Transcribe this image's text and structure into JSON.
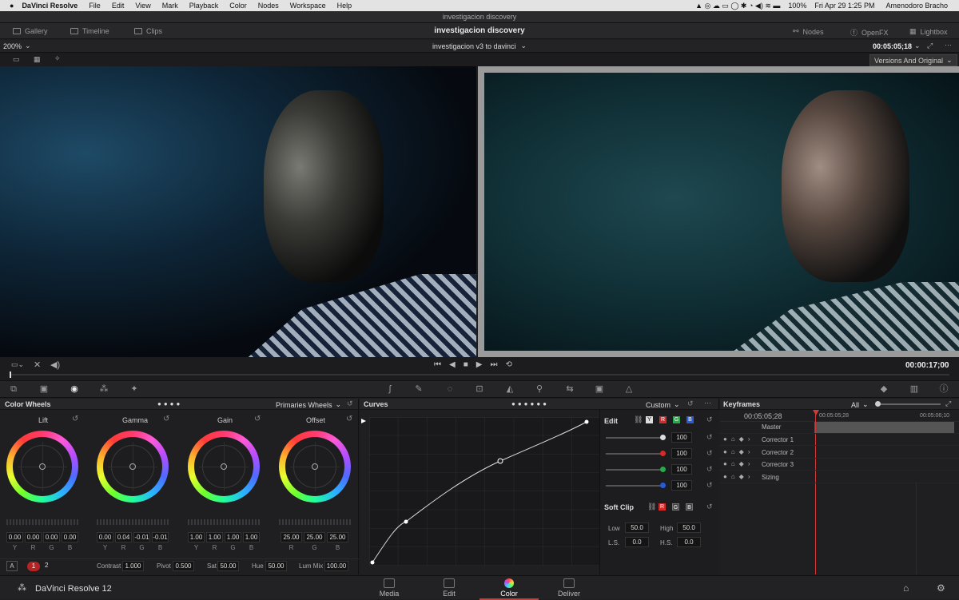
{
  "menubar": {
    "apple": "",
    "app": "DaVinci Resolve",
    "items": [
      "File",
      "Edit",
      "View",
      "Mark",
      "Playback",
      "Color",
      "Nodes",
      "Workspace",
      "Help"
    ],
    "battery": "100%",
    "datetime": "Fri Apr 29  1:25 PM",
    "user": "Amenodoro Bracho"
  },
  "window_title": "investigacion discovery",
  "topbar": {
    "gallery": "Gallery",
    "timeline": "Timeline",
    "clips": "Clips",
    "project": "investigacion discovery",
    "nodes": "Nodes",
    "openfx": "OpenFX",
    "lightbox": "Lightbox"
  },
  "toolbar2": {
    "zoom": "200%",
    "timeline_name": "investigacion v3 to davinci",
    "timecode": "00:05:05;18"
  },
  "toolbar3": {
    "versions": "Versions And Original"
  },
  "transport": {
    "timecode": "00:00:17;00"
  },
  "colorwheels": {
    "title": "Color Wheels",
    "mode": "Primaries Wheels",
    "wheels": [
      {
        "name": "Lift",
        "values": [
          "0.00",
          "0.00",
          "0.00",
          "0.00"
        ],
        "labels": [
          "Y",
          "R",
          "G",
          "B"
        ]
      },
      {
        "name": "Gamma",
        "values": [
          "0.00",
          "0.04",
          "-0.01",
          "-0.01"
        ],
        "labels": [
          "Y",
          "R",
          "G",
          "B"
        ]
      },
      {
        "name": "Gain",
        "values": [
          "1.00",
          "1.00",
          "1.00",
          "1.00"
        ],
        "labels": [
          "Y",
          "R",
          "G",
          "B"
        ]
      },
      {
        "name": "Offset",
        "values": [
          "25.00",
          "25.00",
          "25.00"
        ],
        "labels": [
          "R",
          "G",
          "B"
        ]
      }
    ],
    "footer": {
      "a": "A",
      "page1": "1",
      "page2": "2",
      "contrast_label": "Contrast",
      "contrast": "1.000",
      "pivot_label": "Pivot",
      "pivot": "0.500",
      "sat_label": "Sat",
      "sat": "50.00",
      "hue_label": "Hue",
      "hue": "50.00",
      "lummix_label": "Lum Mix",
      "lummix": "100.00"
    }
  },
  "curves": {
    "title": "Curves",
    "mode": "Custom",
    "edit_label": "Edit",
    "channels": [
      "Y",
      "R",
      "G",
      "B"
    ],
    "intensity": [
      "100",
      "100",
      "100",
      "100"
    ],
    "softclip_label": "Soft Clip",
    "low_label": "Low",
    "low": "50.0",
    "high_label": "High",
    "high": "50.0",
    "ls_label": "L.S.",
    "ls": "0.0",
    "hs_label": "H.S.",
    "hs": "0.0"
  },
  "keyframes": {
    "title": "Keyframes",
    "filter": "All",
    "timecode": "00:05:05;28",
    "tc_start": "00:05:05;28",
    "tc_end": "00:05:06;10",
    "rows": [
      "Master",
      "Corrector 1",
      "Corrector 2",
      "Corrector 3",
      "Sizing"
    ]
  },
  "bottombar": {
    "app": "DaVinci Resolve 12",
    "pages": [
      "Media",
      "Edit",
      "Color",
      "Deliver"
    ],
    "active_page": "Color"
  },
  "colors": {
    "accent": "#d23a3a",
    "panel": "#1f1f21",
    "channel_red": "#d42a2a",
    "channel_green": "#2aa84a",
    "channel_blue": "#2a5ad4"
  }
}
